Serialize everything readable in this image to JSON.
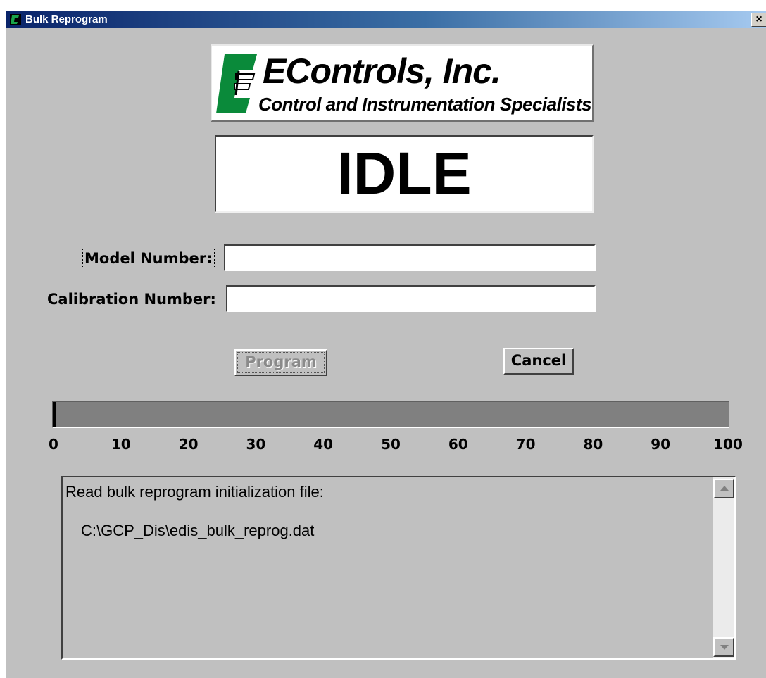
{
  "window": {
    "title": "Bulk Reprogram",
    "close_label": "×"
  },
  "logo": {
    "company": "EControls, Inc.",
    "tagline": "Control and Instrumentation Specialists",
    "icon": "econtrols-logo-icon",
    "brand_color": "#0a8a3a"
  },
  "status": {
    "text": "IDLE"
  },
  "form": {
    "model_label": "Model Number:",
    "model_value": "",
    "calibration_label": "Calibration Number:",
    "calibration_value": ""
  },
  "buttons": {
    "program_label": "Program",
    "program_enabled": false,
    "cancel_label": "Cancel"
  },
  "progress": {
    "value": 0,
    "ticks": [
      "0",
      "10",
      "20",
      "30",
      "40",
      "50",
      "60",
      "70",
      "80",
      "90",
      "100"
    ]
  },
  "log": {
    "line1": "Read bulk reprogram initialization file:",
    "line2": "C:\\GCP_Dis\\edis_bulk_reprog.dat"
  }
}
